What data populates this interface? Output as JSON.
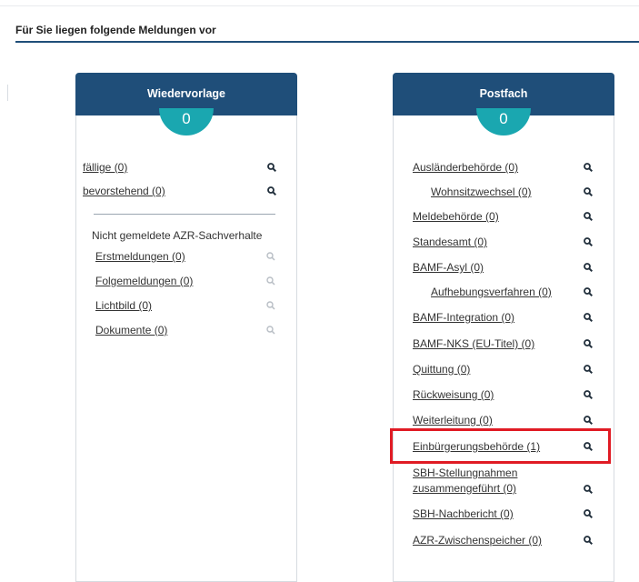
{
  "page": {
    "heading": "Für Sie liegen folgende Meldungen vor"
  },
  "wiedervorlage": {
    "title": "Wiedervorlage",
    "count": "0",
    "items": [
      {
        "label": "fällige (0)"
      },
      {
        "label": "bevorstehend (0)"
      }
    ],
    "section_title": "Nicht gemeldete AZR-Sachverhalte",
    "section_items": [
      {
        "label": "Erstmeldungen (0)"
      },
      {
        "label": "Folgemeldungen (0)"
      },
      {
        "label": "Lichtbild (0)"
      },
      {
        "label": "Dokumente (0)"
      }
    ]
  },
  "postfach": {
    "title": "Postfach",
    "count": "0",
    "items": [
      {
        "label": "Ausländerbehörde (0)"
      },
      {
        "label": "Wohnsitzwechsel (0)"
      },
      {
        "label": "Meldebehörde (0)"
      },
      {
        "label": "Standesamt (0)"
      },
      {
        "label": "BAMF-Asyl (0)"
      },
      {
        "label": "Aufhebungsverfahren (0)"
      },
      {
        "label": "BAMF-Integration (0)"
      },
      {
        "label": "BAMF-NKS (EU-Titel) (0)"
      },
      {
        "label": "Quittung (0)"
      },
      {
        "label": "Rückweisung (0)"
      },
      {
        "label": "Weiterleitung (0)"
      },
      {
        "label": "Einbürgerungsbehörde (1)"
      },
      {
        "label_line1": "SBH-Stellungnahmen",
        "label_line2": "zusammengeführt (0)"
      },
      {
        "label": "SBH-Nachbericht (0)"
      },
      {
        "label": "AZR-Zwischenspeicher (0)"
      }
    ]
  },
  "colors": {
    "header_blue": "#1f4e79",
    "badge_teal": "#1aa7b0",
    "highlight_red": "#e01b24",
    "icon_active": "#1f2d3a",
    "icon_disabled": "#b8bec5"
  },
  "icons": {
    "search": "magnifier-icon"
  }
}
